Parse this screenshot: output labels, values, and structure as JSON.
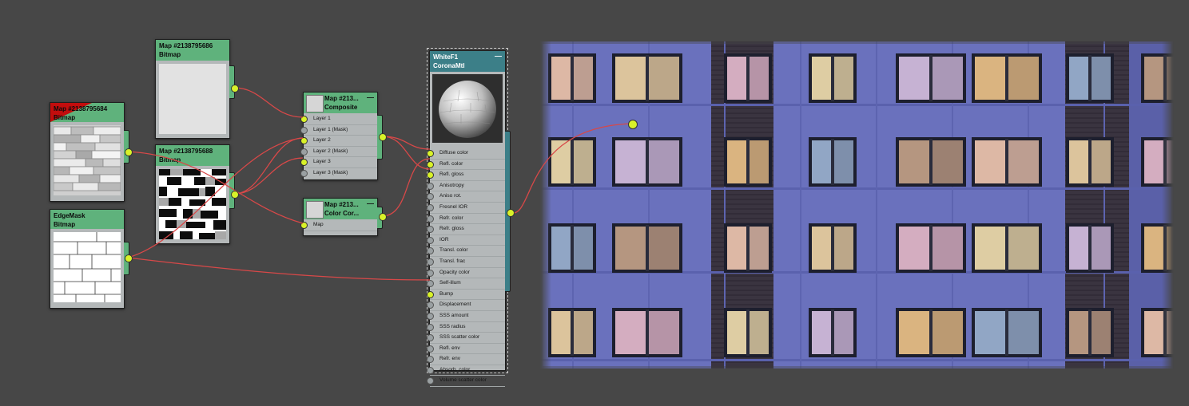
{
  "nodes": {
    "bitmap_top": {
      "title": "Map #2138795686",
      "type": "Bitmap"
    },
    "bitmap_red": {
      "title": "Map #2138795684",
      "type": "Bitmap"
    },
    "bitmap_mid": {
      "title": "Map #2138795688",
      "type": "Bitmap"
    },
    "edgemask": {
      "title": "EdgeMask",
      "type": "Bitmap"
    },
    "composite": {
      "title": "Map #213...",
      "type": "Composite",
      "slots": [
        "Layer 1",
        "Layer 1 (Mask)",
        "Layer 2",
        "Layer 2 (Mask)",
        "Layer 3",
        "Layer 3 (Mask)"
      ]
    },
    "colorcorrect": {
      "title": "Map #213...",
      "type": "Color Cor...",
      "slots": [
        "Map"
      ]
    },
    "material": {
      "title": "WhiteF1",
      "type": "CoronaMtl",
      "slots": [
        "Diffuse color",
        "Refl. color",
        "Refl. gloss",
        "Anisotropy",
        "Aniso rot.",
        "Fresnel IOR",
        "Refr. color",
        "Refr. gloss",
        "IOR",
        "Transl. color",
        "Transl. frac",
        "Opacity color",
        "Self-illum",
        "Bump",
        "Displacement",
        "SSS amount",
        "SSS radius",
        "SSS scatter color",
        "Refl. env",
        "Refr. env",
        "Absorb. color",
        "Volume scatter color"
      ]
    }
  },
  "ui": {
    "collapse_symbol": "—"
  },
  "colors": {
    "canvas": "#474747",
    "node_header": "#5fb27c",
    "node_body": "#b4b8b9",
    "wire": "#d84848",
    "socket_active": "#d9f229",
    "render_facade": "#6c73c0"
  }
}
